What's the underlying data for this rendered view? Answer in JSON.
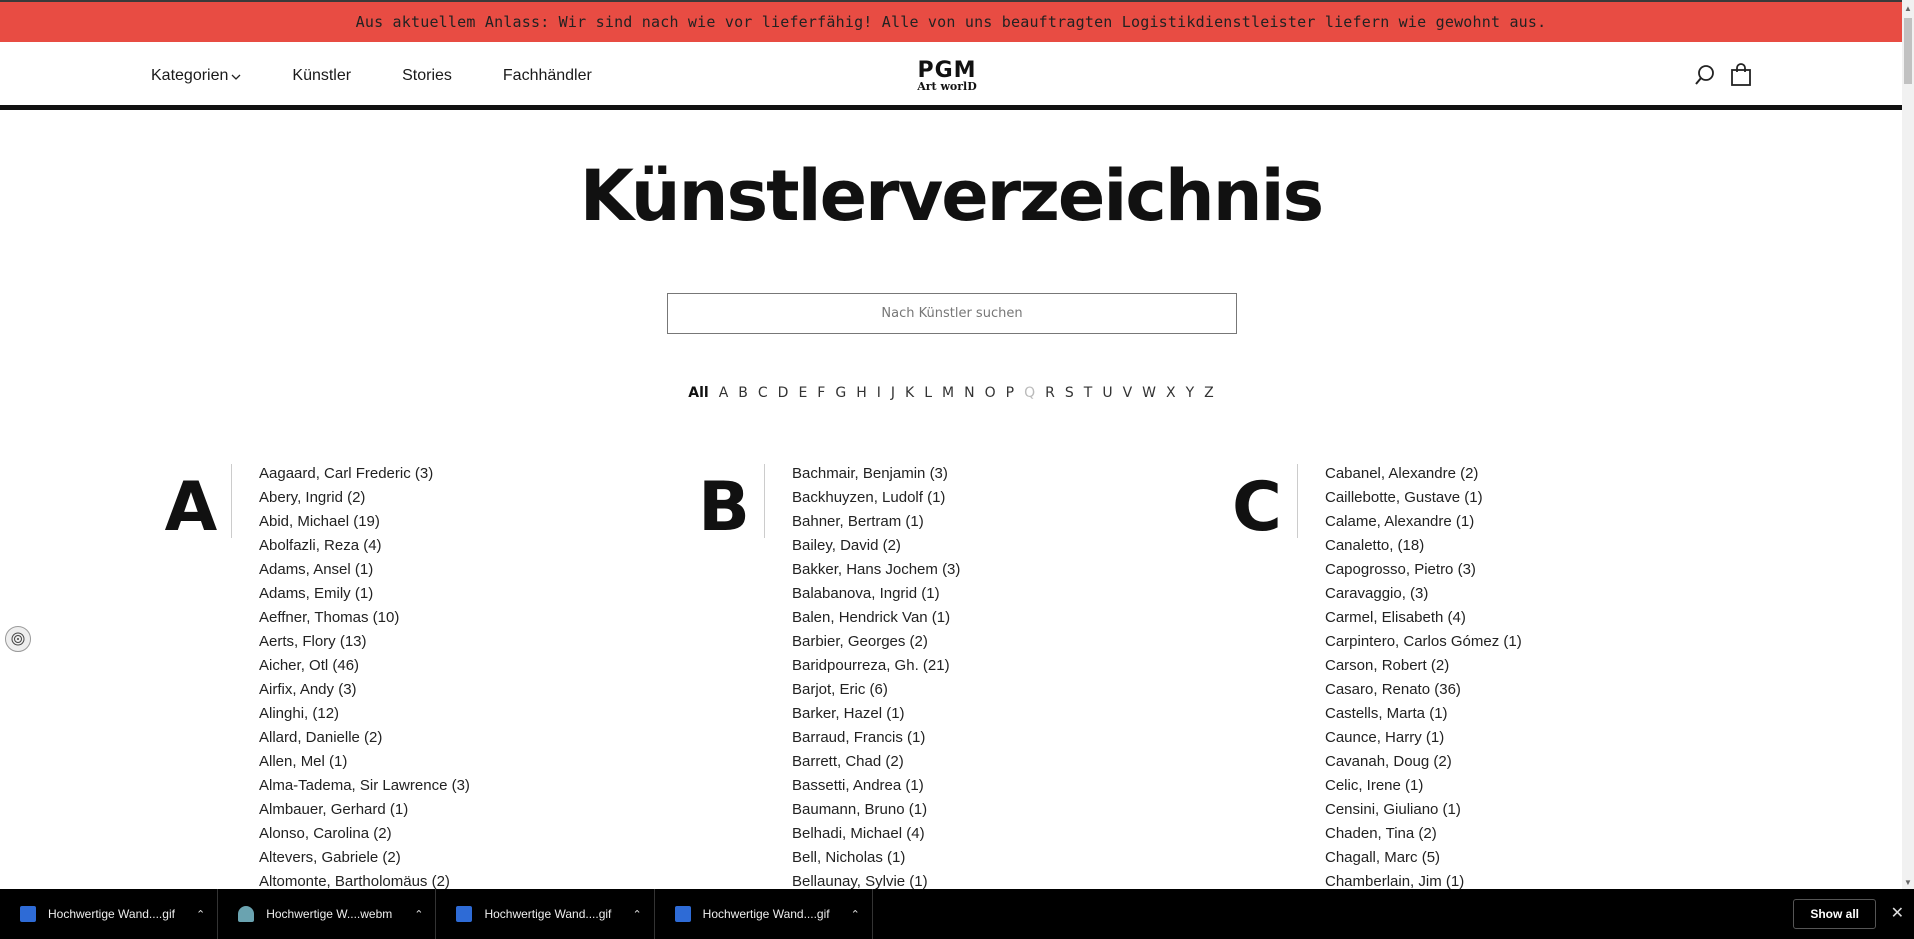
{
  "banner": {
    "text": "Aus aktuellem Anlass: Wir sind nach wie vor lieferfähig! Alle von uns beauftragten Logistikdienstleister liefern wie gewohnt aus."
  },
  "nav": {
    "kategorien": "Kategorien",
    "kuenstler": "Künstler",
    "stories": "Stories",
    "fachhaendler": "Fachhändler"
  },
  "logo": {
    "line1": "PGM",
    "line2": "Art worlD"
  },
  "page": {
    "title": "Künstlerverzeichnis"
  },
  "search": {
    "placeholder": "Nach Künstler suchen"
  },
  "alphabet": {
    "active": "All",
    "letters": [
      "A",
      "B",
      "C",
      "D",
      "E",
      "F",
      "G",
      "H",
      "I",
      "J",
      "K",
      "L",
      "M",
      "N",
      "O",
      "P",
      "Q",
      "R",
      "S",
      "T",
      "U",
      "V",
      "W",
      "X",
      "Y",
      "Z"
    ],
    "disabled": [
      "Q"
    ]
  },
  "columns": [
    {
      "letter": "A",
      "artists": [
        "Aagaard, Carl Frederic (3)",
        "Abery, Ingrid (2)",
        "Abid, Michael (19)",
        "Abolfazli, Reza (4)",
        "Adams, Ansel (1)",
        "Adams, Emily (1)",
        "Aeffner, Thomas (10)",
        "Aerts, Flory (13)",
        "Aicher, Otl (46)",
        "Airfix, Andy (3)",
        "Alinghi, (12)",
        "Allard, Danielle (2)",
        "Allen, Mel (1)",
        "Alma-Tadema, Sir Lawrence (3)",
        "Almbauer, Gerhard (1)",
        "Alonso, Carolina (2)",
        "Altevers, Gabriele (2)",
        "Altomonte, Bartholomäus (2)"
      ]
    },
    {
      "letter": "B",
      "artists": [
        "Bachmair, Benjamin (3)",
        "Backhuyzen, Ludolf (1)",
        "Bahner, Bertram (1)",
        "Bailey, David (2)",
        "Bakker, Hans Jochem (3)",
        "Balabanova, Ingrid (1)",
        "Balen, Hendrick Van (1)",
        "Barbier, Georges (2)",
        "Baridpourreza, Gh. (21)",
        "Barjot, Eric (6)",
        "Barker, Hazel (1)",
        "Barraud, Francis (1)",
        "Barrett, Chad (2)",
        "Bassetti, Andrea (1)",
        "Baumann, Bruno (1)",
        "Belhadi, Michael (4)",
        "Bell, Nicholas (1)",
        "Bellaunay, Sylvie (1)"
      ]
    },
    {
      "letter": "C",
      "artists": [
        "Cabanel, Alexandre (2)",
        "Caillebotte, Gustave (1)",
        "Calame, Alexandre (1)",
        "Canaletto, (18)",
        "Capogrosso, Pietro (3)",
        "Caravaggio, (3)",
        "Carmel, Elisabeth (4)",
        "Carpintero, Carlos Gómez (1)",
        "Carson, Robert (2)",
        "Casaro, Renato (36)",
        "Castells, Marta (1)",
        "Caunce, Harry (1)",
        "Cavanah, Doug (2)",
        "Celic, Irene (1)",
        "Censini, Giuliano (1)",
        "Chaden, Tina (2)",
        "Chagall, Marc (5)",
        "Chamberlain, Jim (1)"
      ]
    }
  ],
  "downloads": [
    {
      "name": "Hochwertige Wand....gif",
      "type": "gif"
    },
    {
      "name": "Hochwertige W....webm",
      "type": "webm"
    },
    {
      "name": "Hochwertige Wand....gif",
      "type": "gif"
    },
    {
      "name": "Hochwertige Wand....gif",
      "type": "gif"
    }
  ],
  "taskbar": {
    "show_all": "Show all"
  }
}
